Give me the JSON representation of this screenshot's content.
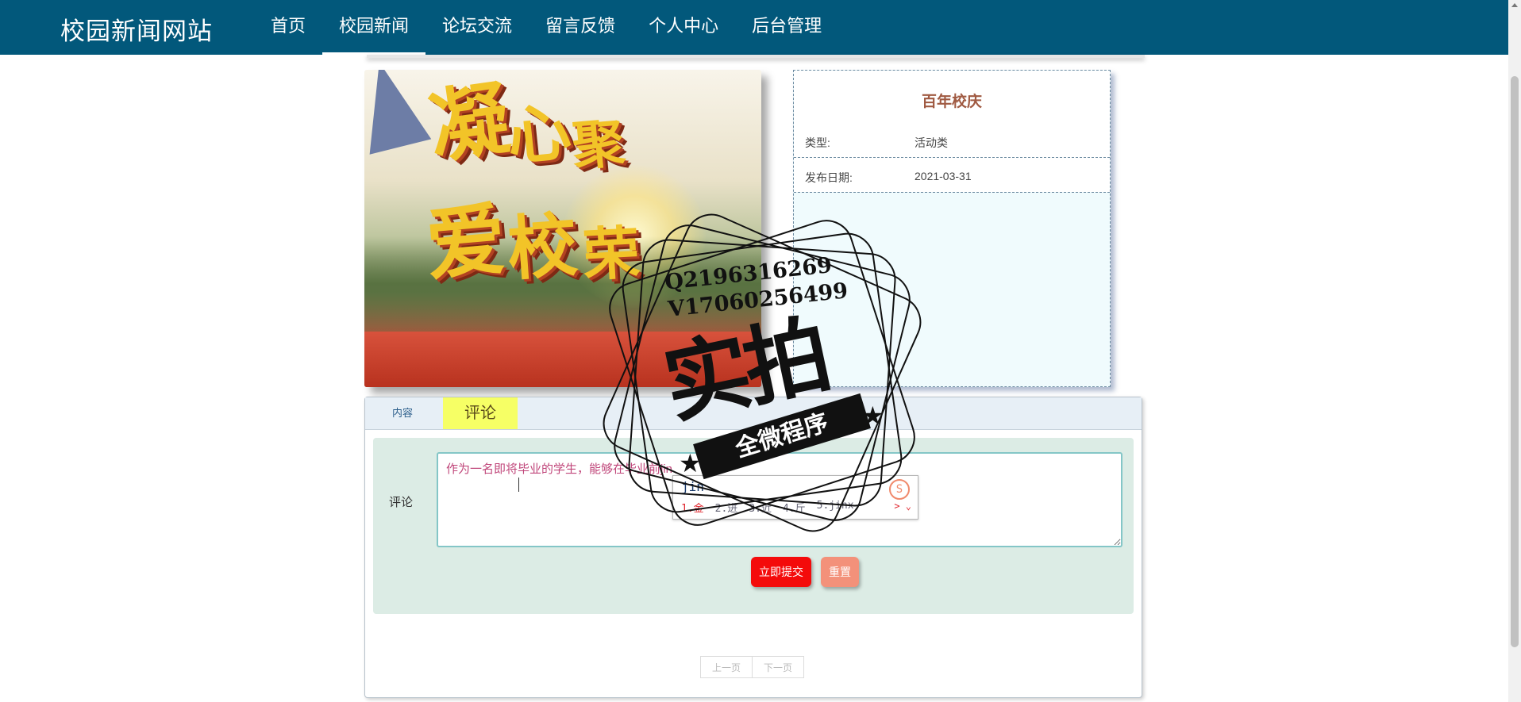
{
  "site": {
    "title": "校园新闻网站"
  },
  "nav": {
    "items": [
      {
        "label": "首页",
        "active": false
      },
      {
        "label": "校园新闻",
        "active": true
      },
      {
        "label": "论坛交流",
        "active": false
      },
      {
        "label": "留言反馈",
        "active": false
      },
      {
        "label": "个人中心",
        "active": false
      },
      {
        "label": "后台管理",
        "active": false
      }
    ]
  },
  "news": {
    "title": "百年校庆",
    "image_chars": [
      "凝",
      "心",
      "聚",
      "爱",
      "校",
      "荣"
    ],
    "fields": [
      {
        "key": "类型:",
        "value": "活动类"
      },
      {
        "key": "发布日期:",
        "value": "2021-03-31"
      }
    ]
  },
  "tabs": {
    "content": "内容",
    "comment": "评论",
    "active": "comment"
  },
  "comment": {
    "label": "评论",
    "value": "作为一名即将毕业的学生，能够在毕业前jin",
    "submit": "立即提交",
    "reset": "重置"
  },
  "pager": {
    "prev": "上一页",
    "next": "下一页"
  },
  "ime": {
    "input": "jin",
    "candidates": [
      "1.金",
      "2.进",
      "3.近",
      "4.斤",
      "5.jinx"
    ],
    "arrows": "> ⌄"
  },
  "watermark": {
    "line1": "Q2196316269",
    "line2": "V17060256499",
    "main": "实拍",
    "ribbon": "全微程序"
  },
  "colors": {
    "nav_bg": "#02587b",
    "title": "#a05a42",
    "submit": "#f40b0b",
    "reset": "#f3917a",
    "comment_tab": "#f6ff65"
  }
}
